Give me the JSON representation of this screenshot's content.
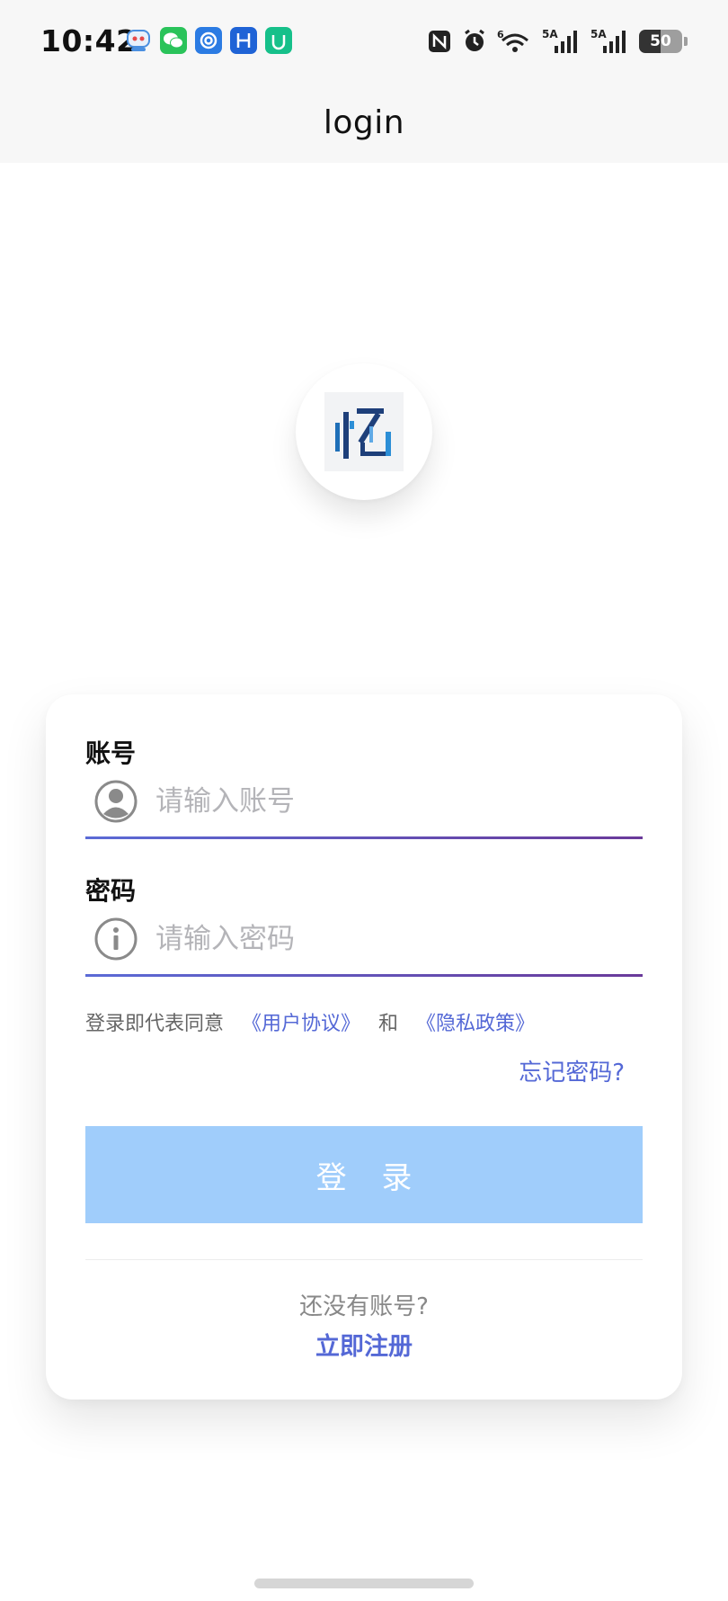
{
  "status_bar": {
    "time": "10:42",
    "notification_icons": [
      "robot-app-icon",
      "wechat-icon",
      "browser-app-icon",
      "h-app-icon",
      "mi-home-icon"
    ],
    "system_icons": [
      "nfc-icon",
      "alarm-icon",
      "wifi-6-icon",
      "signal-5a-icon",
      "signal-5a-icon"
    ],
    "network_label_1": "5A",
    "network_label_2": "5A",
    "wifi_label": "6",
    "battery": "50",
    "battery_level": 0.5
  },
  "header": {
    "title": "login"
  },
  "logo": {
    "icon": "app-logo"
  },
  "form": {
    "account": {
      "label": "账号",
      "placeholder": "请输入账号",
      "icon": "user-avatar-icon"
    },
    "password": {
      "label": "密码",
      "placeholder": "请输入密码",
      "icon": "info-icon"
    },
    "agreement": {
      "prefix": "登录即代表同意",
      "user_agreement": "《用户协议》",
      "and": "和",
      "privacy_policy": "《隐私政策》"
    },
    "forgot_password": "忘记密码?",
    "login_button": "登 录",
    "no_account": "还没有账号?",
    "register_now": "立即注册"
  },
  "colors": {
    "accent": "#5468d6",
    "login_button_bg": "#a0cdfb",
    "underline_start": "#5b6bd6",
    "underline_end": "#6a3a9a"
  }
}
